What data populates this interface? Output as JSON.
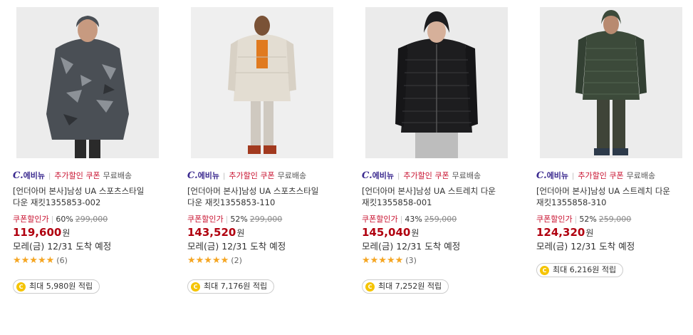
{
  "colors": {
    "brand": "#3b2a8f",
    "promo": "#c8102e",
    "price": "#b0000f",
    "star": "#f5a623",
    "coin": "#f5c400"
  },
  "products": [
    {
      "brand_mark": "C.",
      "brand_suffix": "에비뉴",
      "promo_text": "추가할인 쿠폰",
      "shipping_text": "무료배송",
      "title_line1": "[언더아머 본사]남성 UA 스포츠스타일",
      "title_line2": "다운 재킷1355853-002",
      "price_label": "쿠폰할인가",
      "discount_rate": "60%",
      "original_price": "299,000",
      "sale_price": "119,600",
      "currency": "원",
      "delivery": "모레(금) 12/31 도착 예정",
      "stars": "★★★★★",
      "review_count": "(6)",
      "points_text": "최대 5,980원 적립",
      "image_icon": "camo-down-jacket-photo"
    },
    {
      "brand_mark": "C.",
      "brand_suffix": "에비뉴",
      "promo_text": "추가할인 쿠폰",
      "shipping_text": "무료배송",
      "title_line1": "[언더아머 본사]남성 UA 스포츠스타일",
      "title_line2": "다운 재킷1355853-110",
      "price_label": "쿠폰할인가",
      "discount_rate": "52%",
      "original_price": "299,000",
      "sale_price": "143,520",
      "currency": "원",
      "delivery": "모레(금) 12/31 도착 예정",
      "stars": "★★★★★",
      "review_count": "(2)",
      "points_text": "최대 7,176원 적립",
      "image_icon": "white-down-jacket-photo"
    },
    {
      "brand_mark": "C.",
      "brand_suffix": "에비뉴",
      "promo_text": "추가할인 쿠폰",
      "shipping_text": "무료배송",
      "title_line1": "[언더아머 본사]남성 UA 스트레치 다운",
      "title_line2": "재킷1355858-001",
      "price_label": "쿠폰할인가",
      "discount_rate": "43%",
      "original_price": "259,000",
      "sale_price": "145,040",
      "currency": "원",
      "delivery": "모레(금) 12/31 도착 예정",
      "stars": "★★★★★",
      "review_count": "(3)",
      "points_text": "최대 7,252원 적립",
      "image_icon": "black-down-jacket-photo"
    },
    {
      "brand_mark": "C.",
      "brand_suffix": "에비뉴",
      "promo_text": "추가할인 쿠폰",
      "shipping_text": "무료배송",
      "title_line1": "[언더아머 본사]남성 UA 스트레치 다운",
      "title_line2": "재킷1355858-310",
      "price_label": "쿠폰할인가",
      "discount_rate": "52%",
      "original_price": "259,000",
      "sale_price": "124,320",
      "currency": "원",
      "delivery": "모레(금) 12/31 도착 예정",
      "stars": "",
      "review_count": "",
      "points_text": "최대 6,216원 적립",
      "image_icon": "green-down-jacket-photo"
    }
  ]
}
